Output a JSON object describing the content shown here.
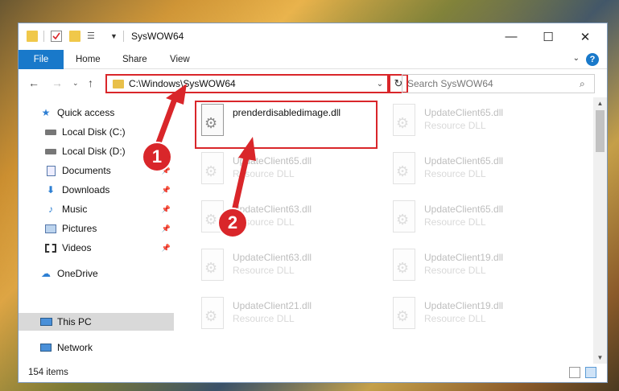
{
  "window": {
    "title": "SysWOW64"
  },
  "ribbon": {
    "tabs": [
      {
        "label": "File"
      },
      {
        "label": "Home"
      },
      {
        "label": "Share"
      },
      {
        "label": "View"
      }
    ],
    "help_glyph": "?"
  },
  "nav": {
    "address": "C:\\Windows\\SysWOW64",
    "search_placeholder": "Search SysWOW64"
  },
  "sidebar": {
    "items": [
      {
        "label": "Quick access",
        "icon": "star-icon"
      },
      {
        "label": "Local Disk (C:)",
        "icon": "drive-icon"
      },
      {
        "label": "Local Disk (D:)",
        "icon": "drive-icon"
      },
      {
        "label": "Documents",
        "icon": "documents-icon"
      },
      {
        "label": "Downloads",
        "icon": "download-icon"
      },
      {
        "label": "Music",
        "icon": "music-icon"
      },
      {
        "label": "Pictures",
        "icon": "pictures-icon"
      },
      {
        "label": "Videos",
        "icon": "videos-icon"
      },
      {
        "label": "OneDrive",
        "icon": "cloud-icon"
      },
      {
        "label": "This PC",
        "icon": "computer-icon"
      },
      {
        "label": "Network",
        "icon": "network-icon"
      }
    ]
  },
  "files": [
    {
      "name": "prenderdisabledimage.dll",
      "type": ""
    },
    {
      "name": "UpdateClient65.dll",
      "type": "Resource DLL"
    },
    {
      "name": "UpdateClient65.dll",
      "type": "Resource DLL"
    },
    {
      "name": "UpdateClient65.dll",
      "type": "Resource DLL"
    },
    {
      "name": "UpdateClient63.dll",
      "type": "Resource DLL"
    },
    {
      "name": "UpdateClient65.dll",
      "type": "Resource DLL"
    },
    {
      "name": "UpdateClient63.dll",
      "type": "Resource DLL"
    },
    {
      "name": "UpdateClient19.dll",
      "type": "Resource DLL"
    },
    {
      "name": "UpdateClient21.dll",
      "type": "Resource DLL"
    },
    {
      "name": "UpdateClient19.dll",
      "type": "Resource DLL"
    }
  ],
  "status": {
    "item_count": "154 items"
  },
  "annotations": [
    {
      "label": "1"
    },
    {
      "label": "2"
    }
  ],
  "colors": {
    "accent": "#1979ca",
    "highlight": "#d9262a",
    "selected_sidebar": "#d9d9d9"
  }
}
